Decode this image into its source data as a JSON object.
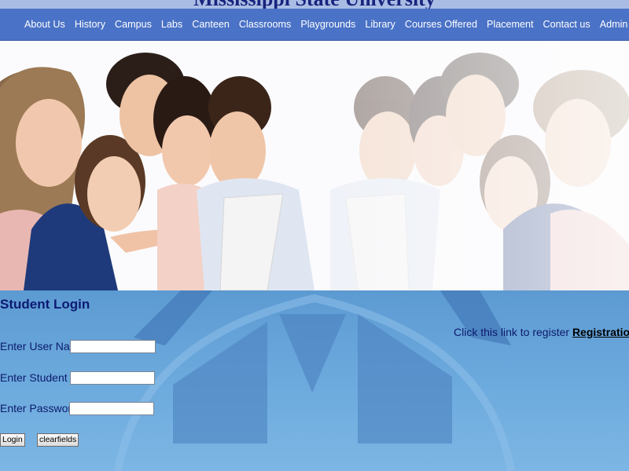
{
  "header": {
    "title": "Mississippi State University"
  },
  "nav": {
    "items": [
      {
        "label": "About Us"
      },
      {
        "label": "History"
      },
      {
        "label": "Campus"
      },
      {
        "label": "Labs"
      },
      {
        "label": "Canteen"
      },
      {
        "label": "Classrooms"
      },
      {
        "label": "Playgrounds"
      },
      {
        "label": "Library"
      },
      {
        "label": "Courses Offered"
      },
      {
        "label": "Placement"
      },
      {
        "label": "Contact us"
      },
      {
        "label": "Admin"
      }
    ]
  },
  "hero": {
    "description": "students-looking-at-laptop-photo"
  },
  "login": {
    "title": "Student Login",
    "username_label": "Enter User Name",
    "username_value": "",
    "student_id_label": "Enter Student ID",
    "student_id_value": "",
    "password_label": "Enter Password .",
    "password_value": "",
    "login_button": "Login",
    "clear_button": "clearfields"
  },
  "register": {
    "prompt": "Click this link to register",
    "link_label": "Registration"
  },
  "colors": {
    "nav_bar": "#4a72c6",
    "top_strip": "#a9bde4",
    "login_bg": "#6aa8dc",
    "label_text": "#0d1a6b"
  }
}
